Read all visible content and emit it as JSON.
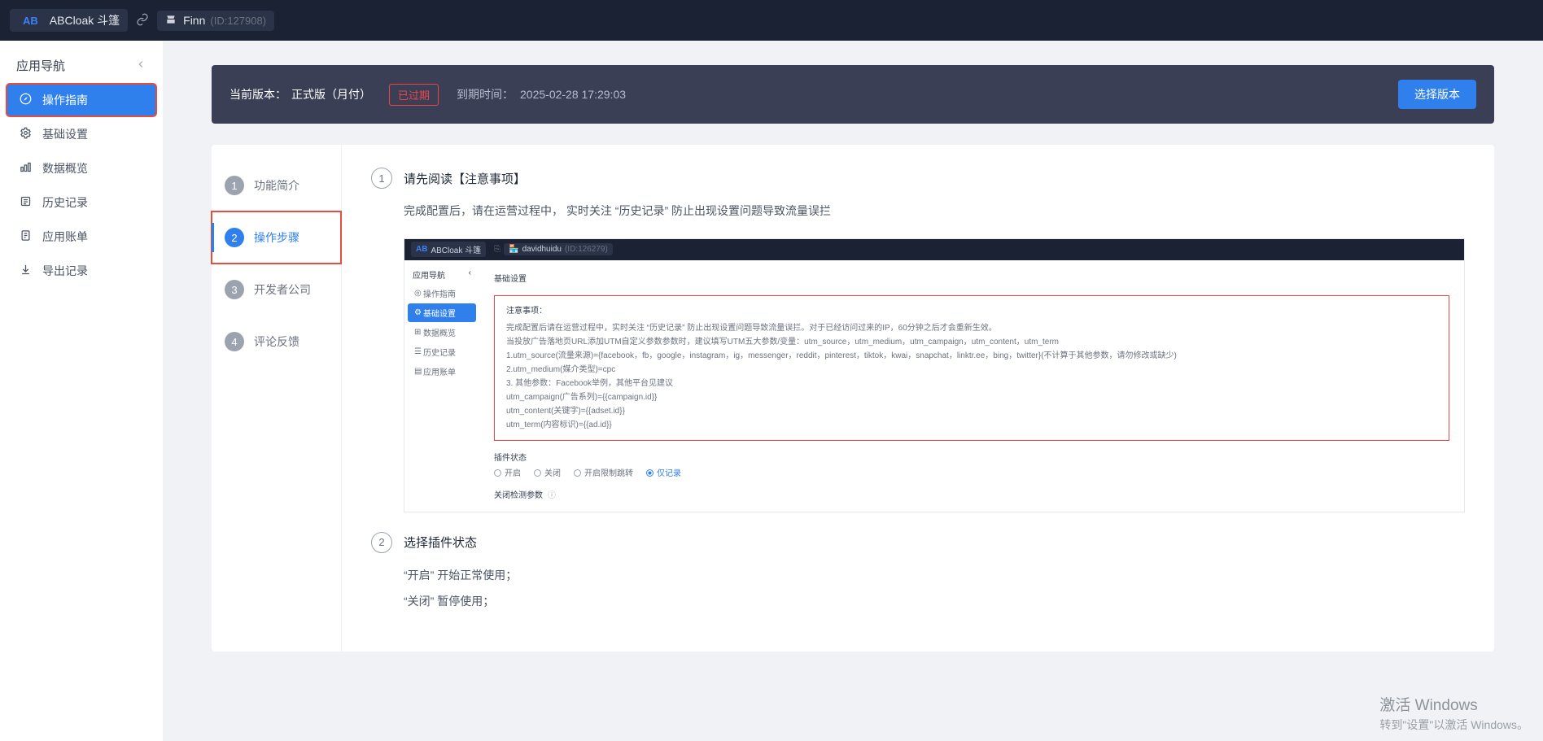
{
  "topbar": {
    "app_icon_text": "AB",
    "app_name": "ABCloak 斗篷",
    "user_name": "Finn",
    "user_id": "(ID:127908)"
  },
  "sidebar": {
    "title": "应用导航",
    "items": [
      {
        "label": "操作指南",
        "icon": "compass"
      },
      {
        "label": "基础设置",
        "icon": "gear"
      },
      {
        "label": "数据概览",
        "icon": "chart"
      },
      {
        "label": "历史记录",
        "icon": "list"
      },
      {
        "label": "应用账单",
        "icon": "bill"
      },
      {
        "label": "导出记录",
        "icon": "download"
      }
    ]
  },
  "banner": {
    "label": "当前版本：",
    "version": "正式版（月付）",
    "expired": "已过期",
    "due_label": "到期时间：",
    "due_time": "2025-02-28 17:29:03",
    "button": "选择版本"
  },
  "steps": [
    {
      "num": "1",
      "label": "功能简介"
    },
    {
      "num": "2",
      "label": "操作步骤"
    },
    {
      "num": "3",
      "label": "开发者公司"
    },
    {
      "num": "4",
      "label": "评论反馈"
    }
  ],
  "section1": {
    "num": "1",
    "title": "请先阅读【注意事项】",
    "body": "完成配置后，请在运营过程中，  实时关注 “历史记录” 防止出现设置问题导致流量误拦"
  },
  "inset": {
    "app_icon_text": "AB",
    "app_name": "ABCloak 斗篷",
    "user_name": "davidhuidu",
    "user_id": "(ID:126279)",
    "side_title": "应用导航",
    "nav": [
      "操作指南",
      "基础设置",
      "数据概览",
      "历史记录",
      "应用账单"
    ],
    "panel_title": "基础设置",
    "box_head": "注意事项：",
    "box_l1": "完成配置后请在运营过程中，实时关注 “历史记录” 防止出现设置问题导致流量误拦。对于已经访问过来的IP，60分钟之后才会重新生效。",
    "box_l2": "当投放广告落地页URL添加UTM自定义参数参数时，建议填写UTM五大参数/变量：utm_source，utm_medium，utm_campaign，utm_content，utm_term",
    "box_l3": "1.utm_source(流量来源)={facebook，fb，google，instagram，ig，messenger，reddit，pinterest，tiktok，kwai，snapchat，linktr.ee，bing，twitter}(不计算于其他参数，请勿修改或缺少)",
    "box_l4": "2.utm_medium(媒介类型)=cpc",
    "box_l5": "3. 其他参数：Facebook举例，其他平台见建议",
    "box_l6": "utm_campaign(广告系列)={{campaign.id}}",
    "box_l7": "utm_content(关键字)={{adset.id}}",
    "box_l8": "utm_term(内容标识)={{ad.id}}",
    "status_label": "插件状态",
    "radios": [
      "开启",
      "关闭",
      "开启限制跳转",
      "仅记录"
    ],
    "close_label": "关闭检测参数"
  },
  "section2": {
    "num": "2",
    "title": "选择插件状态",
    "l1": "“开启” 开始正常使用；",
    "l2": "“关闭” 暂停使用；"
  },
  "watermark": {
    "l1": "激活 Windows",
    "l2": "转到\"设置\"以激活 Windows。"
  }
}
